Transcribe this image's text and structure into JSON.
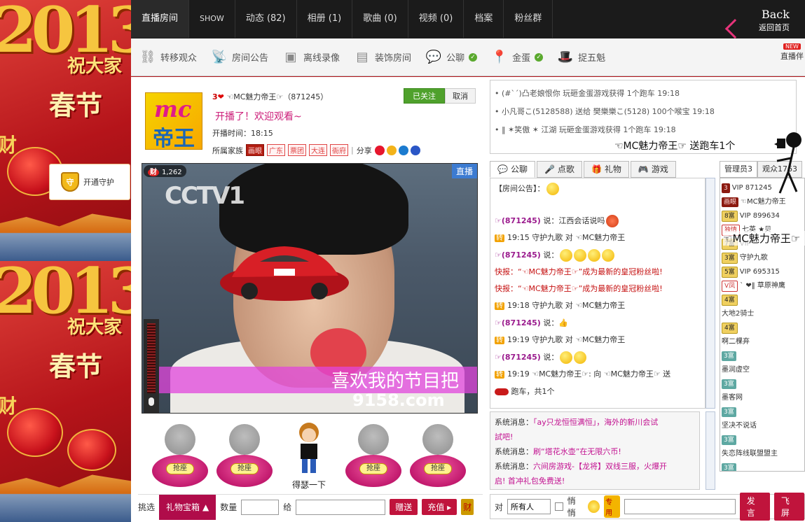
{
  "nav": {
    "tabs": [
      "直播房间",
      "SHOW",
      "动态 (82)",
      "相册 (1)",
      "歌曲 (0)",
      "视频 (0)",
      "档案",
      "粉丝群"
    ],
    "back_title": "Back",
    "back_sub": "返回首页"
  },
  "toolbar": {
    "items": [
      "转移观众",
      "房间公告",
      "离线录像",
      "装饰房间",
      "公聊",
      "金蛋",
      "捉五魁"
    ],
    "new_badge": "NEW",
    "new_label": "直播伴"
  },
  "background": {
    "year": "2013",
    "zhu": "祝大家",
    "chun": "春节",
    "fu": "财",
    "guard_label": "开通守护",
    "guard_icon": "守"
  },
  "anchor": {
    "logo_top": "mc",
    "logo_bottom": "帝王",
    "level": "3",
    "name": "☜MC魅力帝王☞（871245）",
    "hello": "开播了！欢迎观看~",
    "time": "开播时间：18:15",
    "family_label": "所属家族",
    "family_tags": [
      "画眼",
      "广东",
      "票团",
      "大连",
      "衙府"
    ],
    "share_label": "分享",
    "followed": "已关注",
    "cancel": "取消"
  },
  "video": {
    "live": "直播",
    "cai_icon": "财",
    "wealth": "1,262",
    "logo": "CCTV1",
    "band_text": "喜欢我的节目把",
    "site": "9158.com"
  },
  "seats": [
    {
      "label": "抢座"
    },
    {
      "label": "抢座"
    },
    {
      "label": "得瑟一下"
    },
    {
      "label": "抢座"
    },
    {
      "label": "抢座"
    }
  ],
  "gift_bar": {
    "pick": "挑选",
    "box": "礼物宝箱",
    "qty": "数量",
    "to": "给",
    "give": "赠送",
    "recharge": "充值",
    "cai": "财"
  },
  "gift_feed": [
    "(#`ˊ)凸老娘恨你 玩砸金蛋游戏获得 1个跑车 19:18",
    "小凡哥こ(5128588) 送给 樊樂樂こ(5128) 100个喉宝 19:18",
    "‖ ✶笑傲 ✶ 江湖 玩砸金蛋游戏获得 1个跑车 19:18"
  ],
  "overlay": {
    "gift_notice": "☜MC魅力帝王☞ 送跑车1个",
    "name_float": "☜MC魅力帝王☞"
  },
  "chat_tabs": [
    "公聊",
    "点歌",
    "礼物",
    "游戏"
  ],
  "chat": [
    {
      "kind": "ann",
      "text": "【房间公告】："
    },
    {
      "kind": "user",
      "uid": "☞(871245)",
      "text": " 说：江西会话说吗"
    },
    {
      "kind": "zhuan",
      "time": "19:15",
      "text": "守护九歌 对 ☜MC魅力帝王"
    },
    {
      "kind": "user",
      "uid": "☞(871245)",
      "text": " 说："
    },
    {
      "kind": "sys",
      "text": "快报：“☜MC魅力帝王☞”成为最新的皇冠粉丝啦!"
    },
    {
      "kind": "sys",
      "text": "快报：“☜MC魅力帝王☞”成为最新的皇冠粉丝啦!"
    },
    {
      "kind": "zhuan",
      "time": "19:18",
      "text": "守护九歌 对 ☜MC魅力帝王"
    },
    {
      "kind": "user",
      "uid": "☞(871245)",
      "text": " 说："
    },
    {
      "kind": "zhuan",
      "time": "19:19",
      "text": "守护九歌 对 ☜MC魅力帝王"
    },
    {
      "kind": "user",
      "uid": "☞(871245)",
      "text": " 说："
    },
    {
      "kind": "zhuan",
      "time": "19:19",
      "text": "☜MC魅力帝王☞: 向 ☜MC魅力帝王☞ 送"
    },
    {
      "kind": "plain",
      "text": "跑车，共1个"
    }
  ],
  "sys_msgs": [
    {
      "label": "系统消息：",
      "link": "「ay只龙恒恒满恒」，海外的新川会试"
    },
    {
      "label": "",
      "link": "試吧!"
    },
    {
      "label": "系统消息：",
      "link": "刷“塔花水壶”在无限六币!"
    },
    {
      "label": "系统消息：",
      "link": "六间房游戏-【龙将】双线三服，火爆开"
    },
    {
      "label": "",
      "link": "启! 首冲礼包免费送!"
    }
  ],
  "user_tabs": [
    "管理员3",
    "观众1763"
  ],
  "users": [
    {
      "badge": "3",
      "cls": "r",
      "name": "VIP 871245"
    },
    {
      "badge": "画眼",
      "cls": "r",
      "name": "☜MC魅力帝王"
    },
    {
      "badge": "8富",
      "cls": "g",
      "name": "VIP 899634"
    },
    {
      "badge": "独情",
      "cls": "p",
      "name": "七英 ★贝"
    },
    {
      "badge": "7富",
      "cls": "g",
      "name": "VIP"
    },
    {
      "badge": "3富",
      "cls": "g",
      "name": "守护九歌"
    },
    {
      "badge": "5富",
      "cls": "g",
      "name": "VIP 695315"
    },
    {
      "badge": "V凤",
      "cls": "p",
      "name": "` ❤‖ 草原神鹰"
    },
    {
      "badge": "4富",
      "cls": "g",
      "name": ""
    },
    {
      "badge": "",
      "cls": "",
      "name": "大地2骑士"
    },
    {
      "badge": "4富",
      "cls": "g",
      "name": ""
    },
    {
      "badge": "",
      "cls": "",
      "name": "啊二棵弃"
    },
    {
      "badge": "3富",
      "cls": "t",
      "name": ""
    },
    {
      "badge": "",
      "cls": "",
      "name": "墨润虚空"
    },
    {
      "badge": "3富",
      "cls": "t",
      "name": ""
    },
    {
      "badge": "",
      "cls": "",
      "name": "墨客网"
    },
    {
      "badge": "3富",
      "cls": "t",
      "name": ""
    },
    {
      "badge": "",
      "cls": "",
      "name": "坚决不说话"
    },
    {
      "badge": "3富",
      "cls": "t",
      "name": ""
    },
    {
      "badge": "",
      "cls": "",
      "name": "失恋阵线联盟盟主"
    },
    {
      "badge": "3富",
      "cls": "t",
      "name": ""
    }
  ],
  "send_bar": {
    "to": "对",
    "target": "所有人",
    "whisper": "悄悄",
    "cai": "专用",
    "send": "发言",
    "fly": "飞屏"
  }
}
